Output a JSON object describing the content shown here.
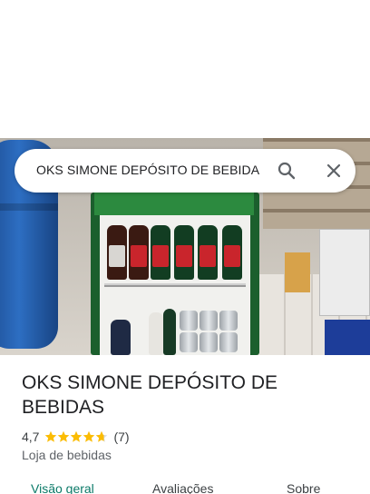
{
  "search": {
    "query": "OKS SIMONE DEPÓSITO DE BEBIDA",
    "search_icon": "search-icon",
    "close_icon": "close-icon"
  },
  "place": {
    "name": "OKS SIMONE DEPÓSITO DE BEBIDAS",
    "rating": "4,7",
    "rating_value": 4.7,
    "stars_max": 5,
    "review_count": "(7)",
    "category": "Loja de bebidas"
  },
  "tabs": [
    {
      "label": "Visão geral",
      "active": true
    },
    {
      "label": "Avaliações",
      "active": false
    },
    {
      "label": "Sobre",
      "active": false
    }
  ],
  "colors": {
    "star": "#fbbc04",
    "active_tab": "#0b7a68",
    "text": "#202124"
  }
}
